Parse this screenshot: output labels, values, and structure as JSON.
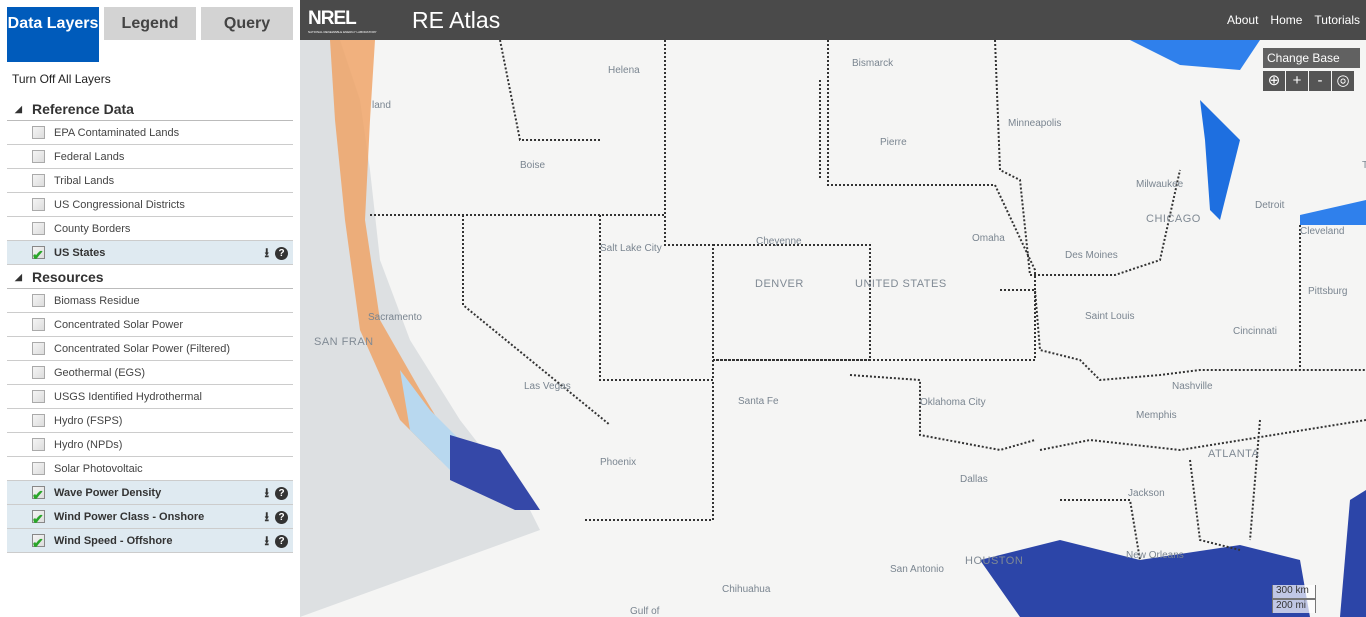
{
  "tabs": [
    {
      "label": "Data Layers",
      "active": true
    },
    {
      "label": "Legend"
    },
    {
      "label": "Query"
    }
  ],
  "turn_off_all": "Turn Off All Layers",
  "groups": [
    {
      "title": "Reference Data",
      "items": [
        {
          "label": "EPA Contaminated Lands",
          "checked": false
        },
        {
          "label": "Federal Lands",
          "checked": false
        },
        {
          "label": "Tribal Lands",
          "checked": false
        },
        {
          "label": "US Congressional Districts",
          "checked": false
        },
        {
          "label": "County Borders",
          "checked": false
        },
        {
          "label": "US States",
          "checked": true
        }
      ]
    },
    {
      "title": "Resources",
      "items": [
        {
          "label": "Biomass Residue",
          "checked": false
        },
        {
          "label": "Concentrated Solar Power",
          "checked": false
        },
        {
          "label": "Concentrated Solar Power (Filtered)",
          "checked": false
        },
        {
          "label": "Geothermal (EGS)",
          "checked": false
        },
        {
          "label": "USGS Identified Hydrothermal",
          "checked": false
        },
        {
          "label": "Hydro (FSPS)",
          "checked": false
        },
        {
          "label": "Hydro (NPDs)",
          "checked": false
        },
        {
          "label": "Solar Photovoltaic",
          "checked": false
        },
        {
          "label": "Wave Power Density",
          "checked": true
        },
        {
          "label": "Wind Power Class - Onshore",
          "checked": true
        },
        {
          "label": "Wind Speed - Offshore",
          "checked": true
        }
      ]
    }
  ],
  "header": {
    "logo": "NREL",
    "logo_sub": "NATIONAL RENEWABLE ENERGY LABORATORY",
    "title": "RE Atlas",
    "nav": [
      "About",
      "Home",
      "Tutorials"
    ]
  },
  "map": {
    "change_base": "Change Base",
    "scale": {
      "km": "300 km",
      "mi": "200 mi"
    },
    "labels": [
      "Helena",
      "Bismarck",
      "Minneapolis",
      "Boise",
      "Pierre",
      "Milwaukee",
      "TORON",
      "Detroit",
      "CHICAGO",
      "Cheyenne",
      "Omaha",
      "Des Moines",
      "Cleveland",
      "Salt Lake City",
      "DENVER",
      "UNITED STATES",
      "Pittsburg",
      "Cincinnati",
      "Saint Louis",
      "Sacramento",
      "SAN FRAN",
      "Las Vegas",
      "Nashville",
      "Santa Fe",
      "Oklahoma City",
      "Memphis",
      "Phoenix",
      "ATLANTA",
      "Dallas",
      "Jackson",
      "HOUSTON",
      "New Orleans",
      "San Antonio",
      "Chihuahua",
      "Gulf of",
      "land"
    ]
  },
  "colors": {
    "accent": "#005bbb",
    "header": "#4a4a4a",
    "check": "#2aa52a"
  }
}
